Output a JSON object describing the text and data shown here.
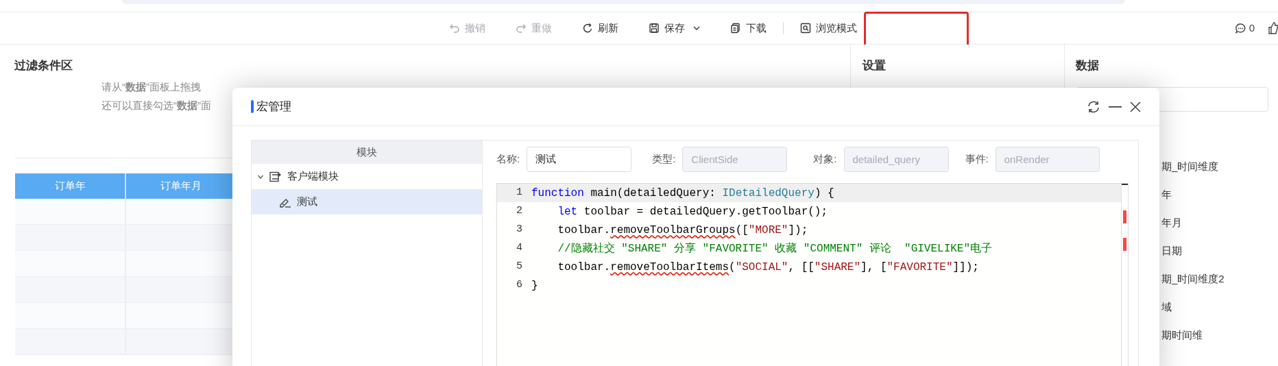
{
  "toolbar": {
    "items": [
      {
        "kind": "undo",
        "label": "撤销",
        "disabled": true
      },
      {
        "kind": "redo",
        "label": "重做",
        "disabled": true
      },
      {
        "kind": "refresh",
        "label": "刷新",
        "disabled": false
      },
      {
        "kind": "save",
        "label": "保存",
        "disabled": false,
        "has_menu": true
      },
      {
        "kind": "download",
        "label": "下载",
        "disabled": false
      },
      {
        "kind": "preview",
        "label": "浏览模式",
        "disabled": false
      }
    ],
    "comment_count": "0"
  },
  "filter_area": {
    "title": "过滤条件区",
    "hint_lines": [
      "请从“**数据**”面板上拖拽",
      "还可以直接勾选“**数据**”面"
    ]
  },
  "table": {
    "columns": [
      "订单年",
      "订单年月"
    ]
  },
  "settings_panel": {
    "title": "设置"
  },
  "data_panel": {
    "title": "数据",
    "fields": [
      "期_时间维度",
      "年",
      "年月",
      "日期",
      "期_时间维度2",
      "域",
      "期时间维"
    ]
  },
  "dialog": {
    "title": "宏管理",
    "module_panel": {
      "header": "模块",
      "tree": [
        {
          "label": "客户端模块",
          "expanded": true,
          "selected": false,
          "children": [
            {
              "label": "测试",
              "selected": true
            }
          ]
        }
      ]
    },
    "form": [
      {
        "label": "名称:",
        "value": "测试",
        "disabled": false
      },
      {
        "label": "类型:",
        "value": "ClientSide",
        "disabled": true
      },
      {
        "label": "对象:",
        "value": "detailed_query",
        "disabled": true
      },
      {
        "label": "事件:",
        "value": "onRender",
        "disabled": true
      }
    ],
    "code": [
      {
        "number": "1",
        "current": true,
        "indented": false,
        "tokens": [
          {
            "kind": "keyword",
            "text": "function"
          },
          {
            "kind": "plain",
            "text": " main(detailedQuery: "
          },
          {
            "kind": "type",
            "text": "IDetailedQuery"
          },
          {
            "kind": "plain",
            "text": ") {"
          }
        ]
      },
      {
        "number": "2",
        "current": false,
        "indented": true,
        "tokens": [
          {
            "kind": "keyword",
            "text": "let"
          },
          {
            "kind": "plain",
            "text": " toolbar = detailedQuery.getToolbar();"
          }
        ]
      },
      {
        "number": "3",
        "current": false,
        "indented": true,
        "tokens": [
          {
            "kind": "plain",
            "text": "toolbar."
          },
          {
            "kind": "error",
            "text": "removeToolbarGroups"
          },
          {
            "kind": "plain",
            "text": "(["
          },
          {
            "kind": "string",
            "text": "\"MORE\""
          },
          {
            "kind": "plain",
            "text": "]);"
          }
        ]
      },
      {
        "number": "4",
        "current": false,
        "indented": true,
        "tokens": [
          {
            "kind": "comment",
            "text": "//隐藏社交 \"SHARE\" 分享 \"FAVORITE\" 收藏 \"COMMENT\" 评论  \"GIVELIKE\"电子"
          }
        ]
      },
      {
        "number": "5",
        "current": false,
        "indented": true,
        "tokens": [
          {
            "kind": "plain",
            "text": "toolbar."
          },
          {
            "kind": "error",
            "text": "removeToolbarItems"
          },
          {
            "kind": "plain",
            "text": "("
          },
          {
            "kind": "string",
            "text": "\"SOCIAL\""
          },
          {
            "kind": "plain",
            "text": ", [["
          },
          {
            "kind": "string",
            "text": "\"SHARE\""
          },
          {
            "kind": "plain",
            "text": "], ["
          },
          {
            "kind": "string",
            "text": "\"FAVORITE\""
          },
          {
            "kind": "plain",
            "text": "]]);"
          }
        ]
      },
      {
        "number": "6",
        "current": false,
        "indented": false,
        "tokens": [
          {
            "kind": "plain",
            "text": "}"
          }
        ]
      }
    ]
  }
}
